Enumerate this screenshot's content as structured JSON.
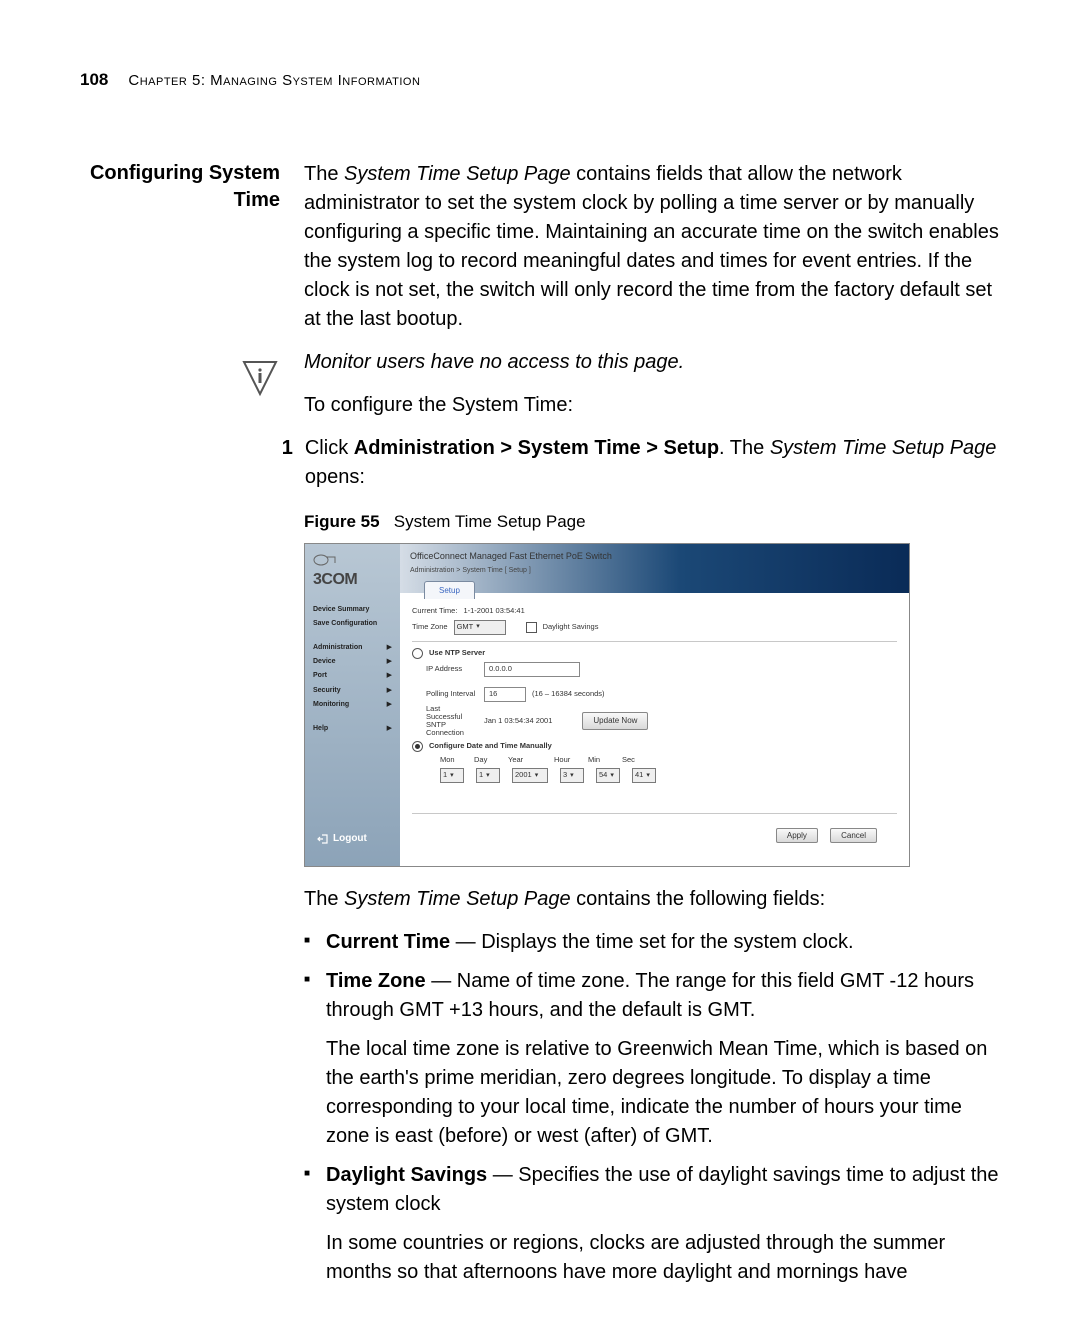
{
  "header": {
    "page_number": "108",
    "chapter": "Chapter 5: Managing System Information"
  },
  "section": {
    "heading": "Configuring System Time",
    "intro": "The System Time Setup Page contains fields that allow the network administrator to set the system clock by polling a time server or by manually configuring a specific time. Maintaining an accurate time on the switch enables the system log to record meaningful dates and times for event entries. If the clock is not set, the switch will only record the time from the factory default set at the last bootup.",
    "note": "Monitor users have no access to this page.",
    "to_configure": "To configure the System Time:",
    "step1_num": "1",
    "step1_prefix": "Click ",
    "step1_path": "Administration > System Time > Setup",
    "step1_suffix": ". The ",
    "step1_italic": "System Time Setup Page",
    "step1_end": " opens:",
    "figure_label": "Figure 55",
    "figure_title": "System Time Setup Page",
    "after_figure": "The System Time Setup Page contains the following fields:",
    "fields": {
      "current_time_term": "Current Time",
      "current_time_desc": " — Displays the time set for the system clock.",
      "time_zone_term": "Time Zone",
      "time_zone_desc": " — Name of time zone. The range for this field GMT -12 hours through GMT +13 hours, and the default is GMT.",
      "time_zone_extra": "The local time zone is relative to Greenwich Mean Time, which is based on the earth's prime meridian, zero degrees longitude. To display a time corresponding to your local time, indicate the number of hours your time zone is east (before) or west (after) of GMT.",
      "dst_term": "Daylight Savings",
      "dst_desc": " — Specifies the use of daylight savings time to adjust the system clock",
      "dst_extra": "In some countries or regions, clocks are adjusted through the summer months so that afternoons have more daylight and mornings have"
    }
  },
  "figure": {
    "logo_text": "3COM",
    "product": "OfficeConnect Managed Fast Ethernet PoE Switch",
    "breadcrumb": "Administration > System Time [ Setup ]",
    "tab": "Setup",
    "sidebar": {
      "device_summary": "Device Summary",
      "save_config": "Save Configuration",
      "administration": "Administration",
      "device": "Device",
      "port": "Port",
      "security": "Security",
      "monitoring": "Monitoring",
      "help": "Help",
      "logout": "Logout"
    },
    "panel": {
      "current_time_lbl": "Current Time:",
      "current_time_val": "1-1-2001 03:54:41",
      "time_zone_lbl": "Time Zone",
      "time_zone_val": "GMT",
      "daylight_lbl": "Daylight Savings",
      "use_ntp_lbl": "Use NTP Server",
      "ip_lbl": "IP Address",
      "ip_val": "0.0.0.0",
      "polling_lbl": "Polling Interval",
      "polling_val": "16",
      "polling_hint": "(16 – 16384 seconds)",
      "last_lbl": "Last Successful SNTP Connection",
      "last_val": "Jan 1 03:54:34 2001",
      "update_btn": "Update Now",
      "manual_lbl": "Configure Date and Time Manually",
      "hdr_mon": "Mon",
      "hdr_day": "Day",
      "hdr_year": "Year",
      "hdr_hour": "Hour",
      "hdr_min": "Min",
      "hdr_sec": "Sec",
      "v_mon": "1",
      "v_day": "1",
      "v_year": "2001",
      "v_hour": "3",
      "v_min": "54",
      "v_sec": "41",
      "apply": "Apply",
      "cancel": "Cancel"
    }
  }
}
